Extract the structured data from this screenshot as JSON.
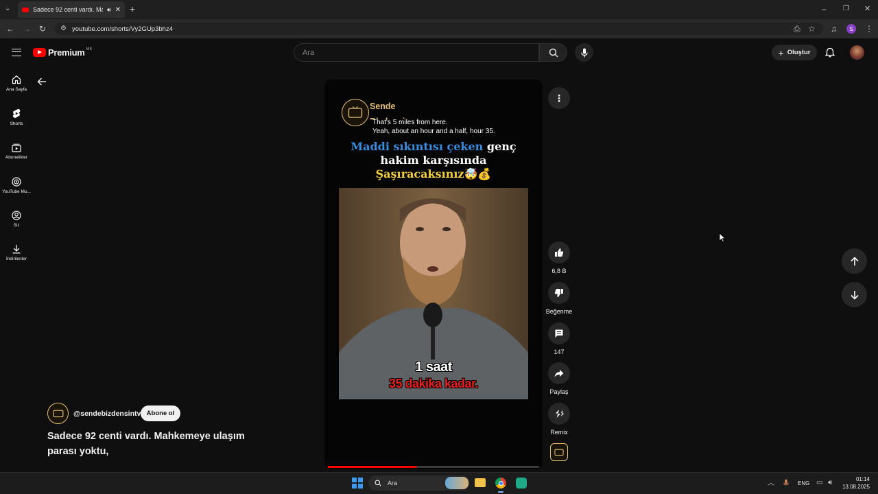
{
  "browser": {
    "tab_title": "Sadece 92 centi vardı. Mahk",
    "url": "youtube.com/shorts/Vy2GUp3bhz4"
  },
  "header": {
    "logo_text": "Premium",
    "region": "MK",
    "search_placeholder": "Ara",
    "create_label": "Oluştur"
  },
  "sidebar": {
    "items": [
      {
        "label": "Ana Sayfa",
        "icon": "home-icon"
      },
      {
        "label": "Shorts",
        "icon": "shorts-icon"
      },
      {
        "label": "Abonelikler",
        "icon": "subscriptions-icon"
      },
      {
        "label": "YouTube Mu...",
        "icon": "music-icon"
      },
      {
        "label": "Siz",
        "icon": "user-icon"
      },
      {
        "label": "İndirilenler",
        "icon": "download-icon"
      }
    ]
  },
  "video": {
    "channel_logo_text": "Sende Bizdensin",
    "caption_en_1": "That's 5 miles from here.",
    "caption_en_2": "Yeah, about an hour and a half, hour 35.",
    "headline_blue": "Maddi sıkıntısı çeken",
    "headline_white_1": "genç",
    "headline_white_2": "hakim karşısında",
    "headline_yellow": "Şaşıracaksınız🤯💰",
    "subtitle_1": "1 saat",
    "subtitle_2": "35 dakika kadar.",
    "progress": 0.42
  },
  "actions": {
    "likes": "6,8 B",
    "dislike": "Beğenme",
    "comments": "147",
    "share": "Paylaş",
    "remix": "Remix"
  },
  "channel": {
    "handle": "@sendebizdensintv",
    "subscribe": "Abone ol",
    "title": "Sadece 92 centi vardı. Mahkemeye ulaşım parası yoktu,"
  },
  "taskbar": {
    "search_placeholder": "Ara",
    "language": "ENG",
    "time": "01:14",
    "date": "13.08.2025"
  },
  "colors": {
    "yt_red": "#ff0000",
    "headline_blue": "#3b8de0",
    "headline_yellow": "#f4d03f",
    "progress_red": "#ff0000"
  }
}
